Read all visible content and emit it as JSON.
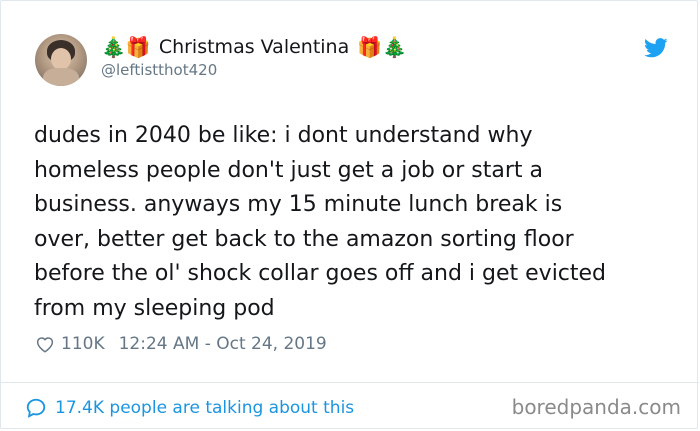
{
  "author": {
    "emoji_left": "🎄🎁",
    "display_name": "Christmas Valentina",
    "emoji_right": "🎁🎄",
    "handle": "@leftistthot420"
  },
  "tweet": {
    "text": "dudes in 2040 be like: i dont understand why\nhomeless people don't just get a job or start a\nbusiness. anyways my 15 minute lunch break is\nover, better get back to the amazon sorting floor\nbefore the ol' shock collar goes off and i get evicted\nfrom my sleeping pod"
  },
  "meta": {
    "like_count": "110K",
    "timestamp": "12:24 AM - Oct 24, 2019"
  },
  "footer": {
    "talking_text": "17.4K people are talking about this",
    "watermark": "boredpanda.com"
  },
  "colors": {
    "twitter_blue": "#1da1f2",
    "link_blue": "#1b95e0",
    "muted_gray": "#657786"
  }
}
